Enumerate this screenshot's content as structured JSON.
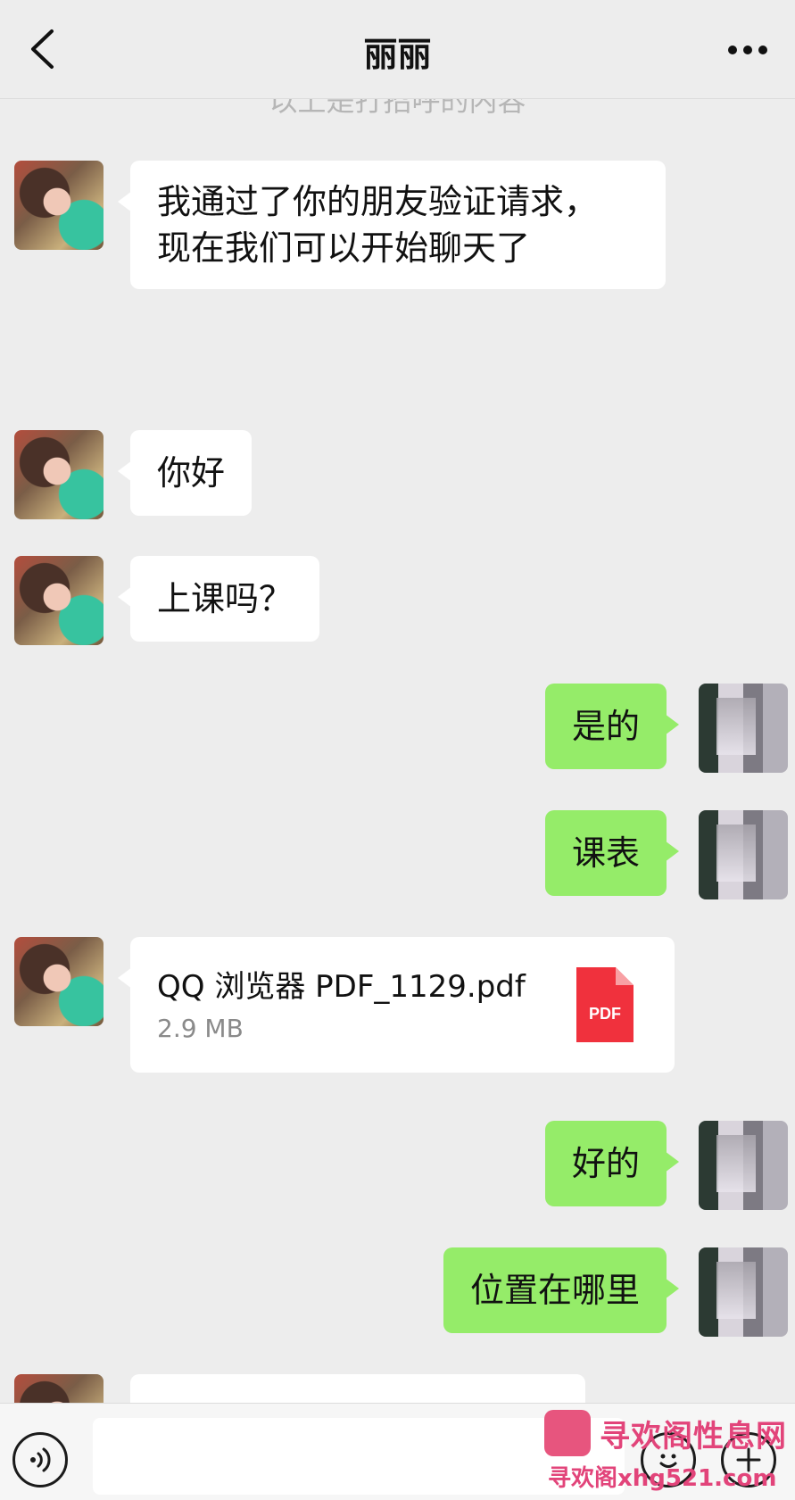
{
  "header": {
    "title": "丽丽"
  },
  "system_note": "以上是打招呼的内容",
  "messages": {
    "m1": {
      "sender": "contact",
      "lines": [
        "我通过了你的朋友验证请求，",
        "现在我们可以开始聊天了"
      ]
    },
    "m2": {
      "sender": "contact",
      "text": "你好"
    },
    "m3": {
      "sender": "contact",
      "text": "上课吗？"
    },
    "m4": {
      "sender": "self",
      "text": "是的"
    },
    "m5": {
      "sender": "self",
      "text": "课表"
    },
    "m6": {
      "sender": "contact",
      "file": {
        "name": "QQ 浏览器 PDF_1129.pdf",
        "size": "2.9 MB",
        "icon_label": "PDF"
      }
    },
    "m7": {
      "sender": "self",
      "text": "好的"
    },
    "m8": {
      "sender": "self",
      "text": "位置在哪里"
    }
  },
  "input": {
    "placeholder": ""
  },
  "watermark": {
    "line1": "寻欢阁性息网",
    "line2": "寻欢阁xhg521.com"
  },
  "colors": {
    "background": "#ededed",
    "bubble_self": "#95ec69",
    "bubble_contact": "#ffffff",
    "pdf_red": "#f0313d",
    "watermark": "#e2447a"
  },
  "icons": {
    "back": "back-arrow-icon",
    "more": "more-dots-icon",
    "voice": "voice-icon",
    "emoji": "emoji-icon",
    "plus": "plus-icon",
    "file": "pdf-file-icon"
  }
}
